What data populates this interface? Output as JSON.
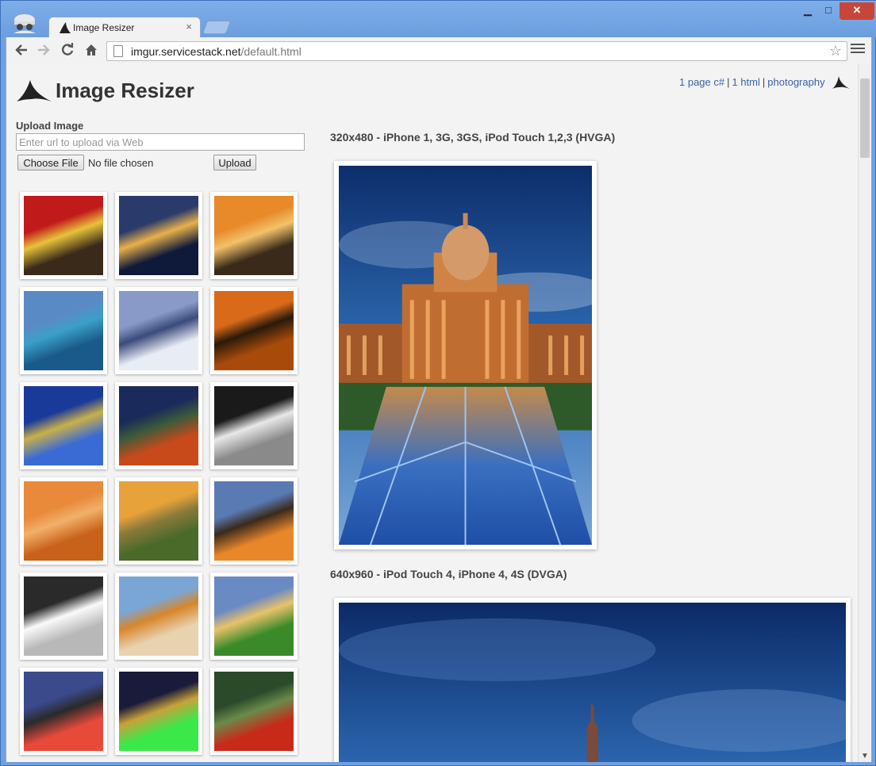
{
  "browser": {
    "tab_title": "Image Resizer",
    "tab_close": "×",
    "url_host": "imgur.servicestack.net",
    "url_path": "/default.html",
    "controls": {
      "minimize": "▁",
      "maximize": "□",
      "close": "✕"
    }
  },
  "header": {
    "title": "Image Resizer",
    "links": [
      "1 page c#",
      "1 html",
      "photography"
    ],
    "separator": "|"
  },
  "upload": {
    "label": "Upload Image",
    "url_placeholder": "Enter url to upload via Web",
    "choose_label": "Choose File",
    "file_status": "No file chosen",
    "upload_label": "Upload"
  },
  "gallery": {
    "thumbnails": [
      "red-tunnel",
      "city-night",
      "horse",
      "blue-lake",
      "waterfall-snow",
      "sunset-boat",
      "blue-hall",
      "autumn-path",
      "dark-arches",
      "orange-hills",
      "great-wall",
      "lone-tree",
      "bw-shore",
      "taj-mahal",
      "cabin-hills",
      "eiffel-tower",
      "aurora-night",
      "red-forest"
    ]
  },
  "sections": [
    {
      "title": "320x480 - iPhone 1, 3G, 3GS, iPod Touch 1,2,3 (HVGA)"
    },
    {
      "title": "640x960 - iPod Touch 4, iPhone 4, 4S (DVGA)"
    }
  ],
  "icons": {
    "back": "arrow-left-icon",
    "forward": "arrow-right-icon",
    "reload": "reload-icon",
    "home": "home-icon",
    "star": "star-icon",
    "menu": "hamburger-menu-icon"
  }
}
